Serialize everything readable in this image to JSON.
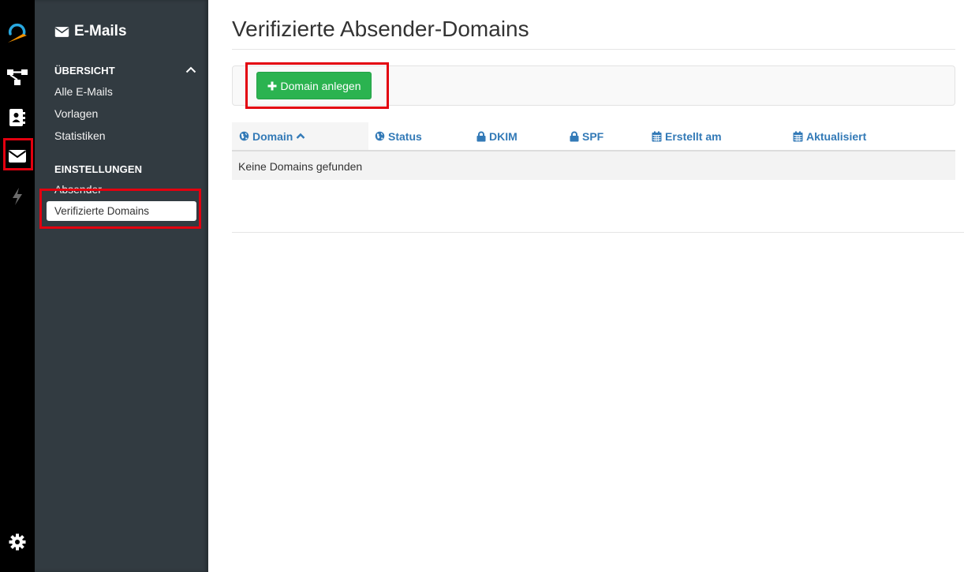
{
  "subnav": {
    "title": "E-Mails",
    "sections": [
      {
        "label": "ÜBERSICHT",
        "items": [
          "Alle E-Mails",
          "Vorlagen",
          "Statistiken"
        ]
      },
      {
        "label": "EINSTELLUNGEN",
        "items": [
          "Absender",
          "Verifizierte Domains"
        ]
      }
    ],
    "active_item": "Verifizierte Domains"
  },
  "main": {
    "title": "Verifizierte Absender-Domains",
    "add_button": "Domain anlegen",
    "table": {
      "columns": [
        "Domain",
        "Status",
        "DKIM",
        "SPF",
        "Erstellt am",
        "Aktualisiert"
      ],
      "empty_text": "Keine Domains gefunden"
    }
  },
  "colors": {
    "rail": "#000000",
    "sidebar": "#323b41",
    "accent": "#337ab7",
    "success": "#2bb350",
    "highlight": "#e3000f",
    "logo_blue": "#29a8e0",
    "logo_orange": "#f39200"
  },
  "icons": [
    "logo-icon",
    "workflow-icon",
    "contacts-icon",
    "envelope-icon",
    "bolt-icon",
    "gear-icon",
    "globe-icon",
    "lock-icon",
    "calendar-icon",
    "plus-icon",
    "chevron-up-icon"
  ]
}
